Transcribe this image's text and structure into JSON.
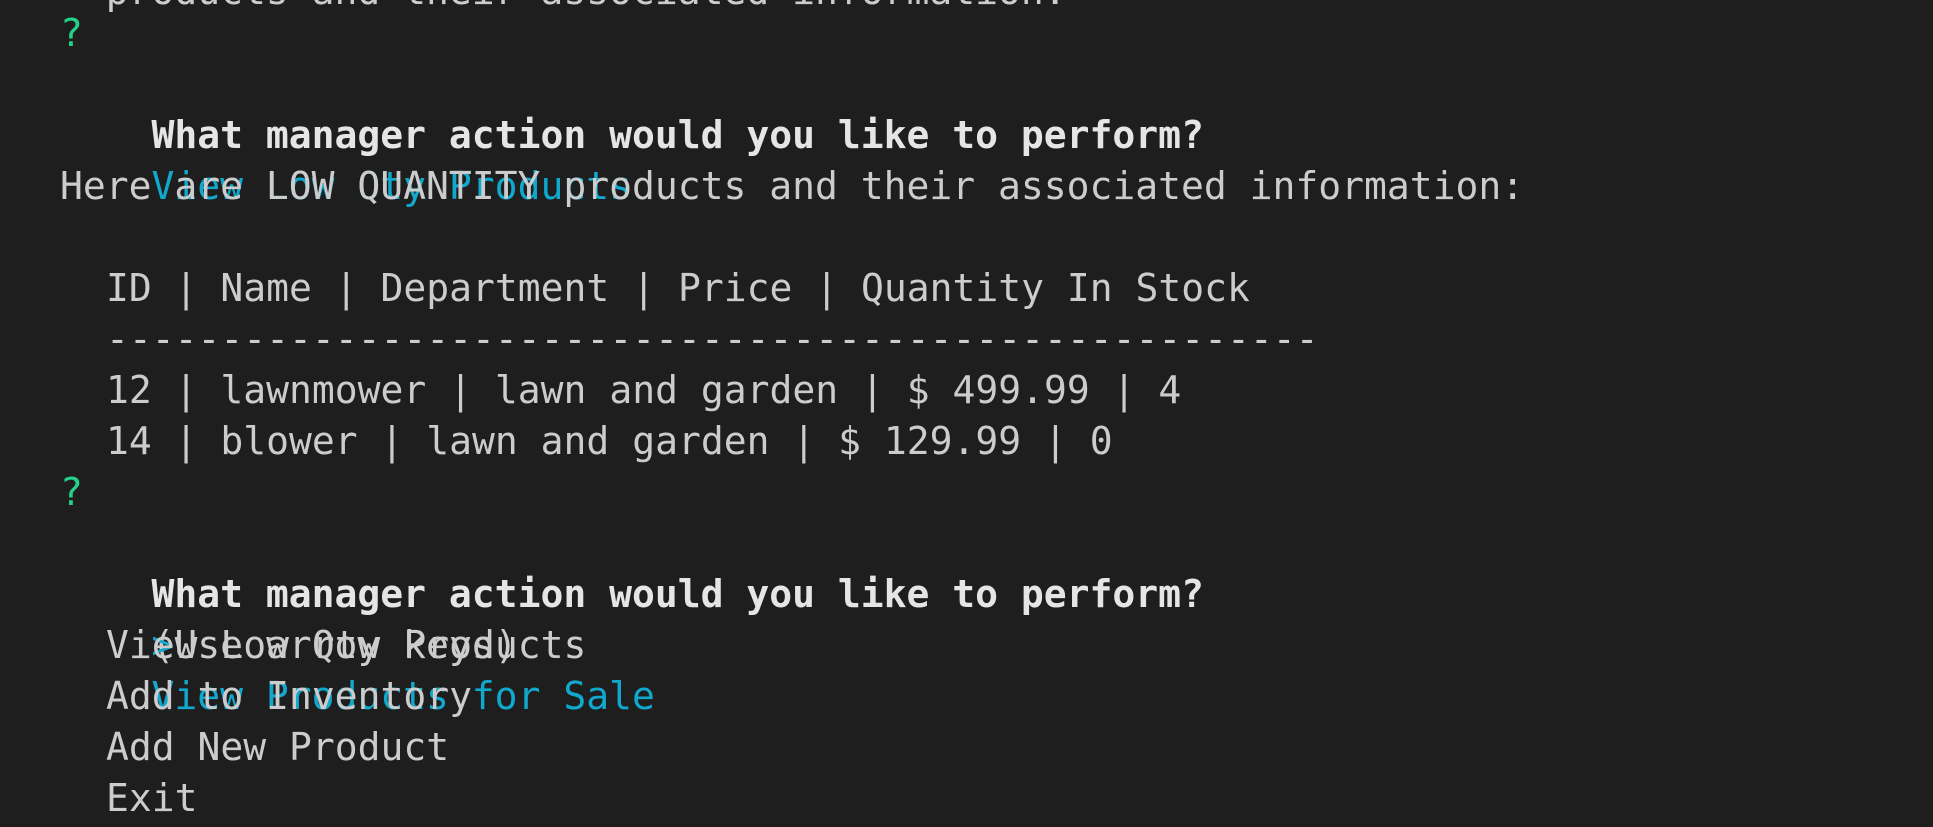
{
  "terminal": {
    "colors": {
      "background": "#1e1e1e",
      "text": "#cccccc",
      "prompt_marker": "#23d18b",
      "highlight": "#11a8cd"
    },
    "cutoff_line": "  products and their associated information:",
    "first_prompt": {
      "marker": "?",
      "question": "What manager action would you like to perform?",
      "answer": "View Low Qty Products"
    },
    "low_qty_heading": "Here are LOW QUANTITY products and their associated information:",
    "table": {
      "header": "ID | Name | Department | Price | Quantity In Stock",
      "separator": "-----------------------------------------------------",
      "rows": [
        "12 | lawnmower | lawn and garden | $ 499.99 | 4",
        "14 | blower | lawn and garden | $ 129.99 | 0"
      ]
    },
    "second_prompt": {
      "marker": "?",
      "question": "What manager action would you like to perform?",
      "hint": "(Use arrow keys)"
    },
    "menu": {
      "pointer": ">",
      "options": [
        "View Products for Sale",
        "View Low Qty Products",
        "Add to Inventory",
        "Add New Product",
        "Exit"
      ],
      "selected_option": "View Products for Sale"
    }
  }
}
